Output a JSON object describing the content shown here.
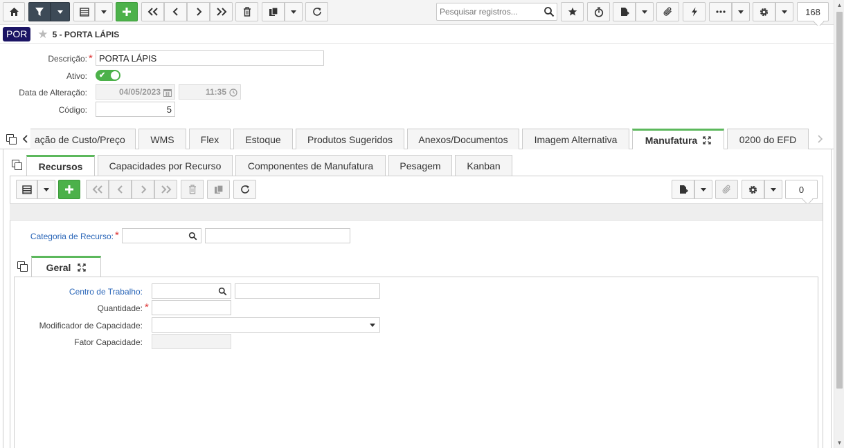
{
  "toolbar": {
    "search_placeholder": "Pesquisar registros...",
    "record_count": "168"
  },
  "title": {
    "badge": "POR",
    "record_title": "5 - PORTA LÁPIS"
  },
  "form": {
    "descricao_label": "Descrição:",
    "descricao_value": "PORTA LÁPIS",
    "ativo_label": "Ativo:",
    "data_alteracao_label": "Data de Alteração:",
    "data_value": "04/05/2023",
    "hora_value": "11:35",
    "codigo_label": "Código:",
    "codigo_value": "5"
  },
  "tabs": {
    "items": [
      "ação de Custo/Preço",
      "WMS",
      "Flex",
      "Estoque",
      "Produtos Sugeridos",
      "Anexos/Documentos",
      "Imagem Alternativa",
      "Manufatura",
      "0200 do EFD"
    ],
    "active": "Manufatura"
  },
  "subtabs": {
    "items": [
      "Recursos",
      "Capacidades por Recurso",
      "Componentes de Manufatura",
      "Pesagem",
      "Kanban"
    ],
    "active": "Recursos"
  },
  "sub_toolbar": {
    "record_count": "0"
  },
  "recurso": {
    "categoria_label": "Categoria de Recurso:"
  },
  "geral": {
    "tab_label": "Geral",
    "centro_trabalho_label": "Centro de Trabalho:",
    "quantidade_label": "Quantidade:",
    "modificador_label": "Modificador de Capacidade:",
    "fator_label": "Fator Capacidade:"
  },
  "colors": {
    "accent_green": "#4cb14a",
    "toolbar_dark": "#3d4a57",
    "badge_navy": "#1b1464",
    "link_blue": "#2a66b8"
  }
}
